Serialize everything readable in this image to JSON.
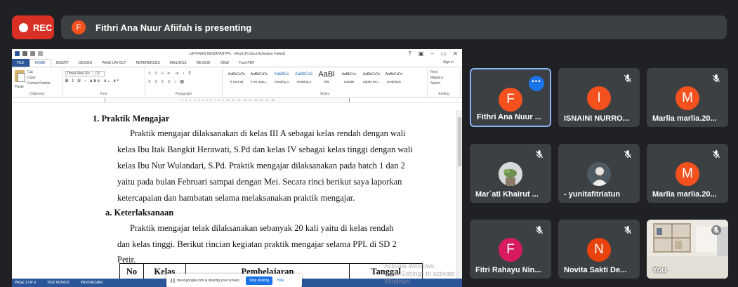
{
  "topbar": {
    "rec_label": "REC",
    "presenter_initial": "F",
    "presenting_text": "Fithri Ana Nuur Afiifah is presenting",
    "colors": {
      "rec": "#d93025",
      "presenter_avatar": "#f4511e",
      "bar": "#3c4043"
    }
  },
  "word": {
    "window_title": "LAPORAN KEGIATAN PPL - Word (Product Activation Failed)",
    "window_controls": [
      "?",
      "▣",
      "–",
      "▭",
      "✕"
    ],
    "sign_in": "Sign in",
    "tabs": [
      "FILE",
      "HOME",
      "INSERT",
      "DESIGN",
      "PAGE LAYOUT",
      "REFERENCES",
      "MAILINGS",
      "REVIEW",
      "VIEW",
      "Foxit PDF"
    ],
    "active_tab": "HOME",
    "clipboard": {
      "paste": "Paste",
      "cut": "Cut",
      "copy": "Copy",
      "format_painter": "Format Painter",
      "label": "Clipboard"
    },
    "font": {
      "name": "Times New Ro",
      "size": "12",
      "row2": "B I U - abc x₂ x²",
      "label": "Font"
    },
    "paragraph": {
      "label": "Paragraph"
    },
    "styles": {
      "label": "Styles",
      "items": [
        {
          "preview": "AaBbCcDc",
          "name": "¶ Normal"
        },
        {
          "preview": "AaBbCcDc",
          "name": "¶ No Spac..."
        },
        {
          "preview": "AaBbCc",
          "name": "Heading 1"
        },
        {
          "preview": "AaBbCcE",
          "name": "Heading 2"
        },
        {
          "preview": "AaBl",
          "name": "Title"
        },
        {
          "preview": "AaBbCcc",
          "name": "Subtitle"
        },
        {
          "preview": "AaBbCcDc",
          "name": "Subtle Em..."
        },
        {
          "preview": "AaBbCcDc",
          "name": "Emphasis"
        }
      ]
    },
    "editing": {
      "find": "Find",
      "replace": "Replace",
      "select": "Select",
      "label": "Editing"
    },
    "ruler": "· 2 · 1 · 1 · 2 · 3 · 4 · 5 · 6 · 7 · 8 · 9 · 10 · 11 · 12 · 13 · 14 · 15 · 16 · 17 · 18",
    "document": {
      "heading1": "1.  Praktik Mengajar",
      "p1": [
        "Praktik mengajar dilaksanakan di kelas III A sebagai kelas rendah dengan wali",
        "kelas Ibu Itak Bangkit Herawati, S.Pd dan kelas IV sebagai kelas tinggi dengan wali",
        "kelas Ibu Nur Wulandari, S.Pd. Praktik mengajar dilaksanakan pada batch 1 dan 2",
        "yaitu pada bulan Februari sampai dengan Mei. Secara rinci berikut saya laporkan",
        "ketercapaian dan hambatan selama melaksanakan praktik mengajar."
      ],
      "heading2": "a.  Keterlaksanaan",
      "p2": [
        "Praktik mengajar telak dilaksanakan sebanyak 20 kali yaitu di kelas rendah",
        "dan kelas tinggi. Berikut rincian kegiatan praktik mengajar selama PPL di SD 2",
        "Petir."
      ],
      "table_headers": [
        "No",
        "Kelas",
        "Pembelajaran",
        "Tanggal"
      ]
    },
    "status_bar": [
      "PAGE 3 OF 6",
      "2032 WORDS",
      "INDONESIAN"
    ],
    "watermark": [
      "Activate Windows",
      "Go to Settings to activate Windows."
    ]
  },
  "share_notice": {
    "text": "meet.google.com is sharing your screen.",
    "stop_label": "Stop sharing",
    "hide_label": "Hide"
  },
  "participants": [
    {
      "name": "Fithri Ana Nuur ...",
      "initial": "F",
      "color": "#f4511e",
      "selected": true
    },
    {
      "name": "ISNAINI NURRO...",
      "initial": "I",
      "color": "#f4511e",
      "muted": true
    },
    {
      "name": "Marlia marlia.20...",
      "initial": "M",
      "color": "#f4511e",
      "muted": true
    },
    {
      "name": "Mar`ati Khairut ...",
      "initial": "",
      "photo": "plant",
      "muted": true
    },
    {
      "name": "- yunitafitriatun",
      "initial": "",
      "photo": "person",
      "muted": true
    },
    {
      "name": "Marlia marlia.20...",
      "initial": "M",
      "color": "#f4511e",
      "muted": true
    },
    {
      "name": "Fitri Rahayu Nin...",
      "initial": "F",
      "color": "#d81b60",
      "muted": true
    },
    {
      "name": "Novita Sakti De...",
      "initial": "N",
      "color": "#e8430e",
      "muted": true
    },
    {
      "name": "You",
      "initial": "",
      "photo": "room",
      "muted": true
    }
  ]
}
